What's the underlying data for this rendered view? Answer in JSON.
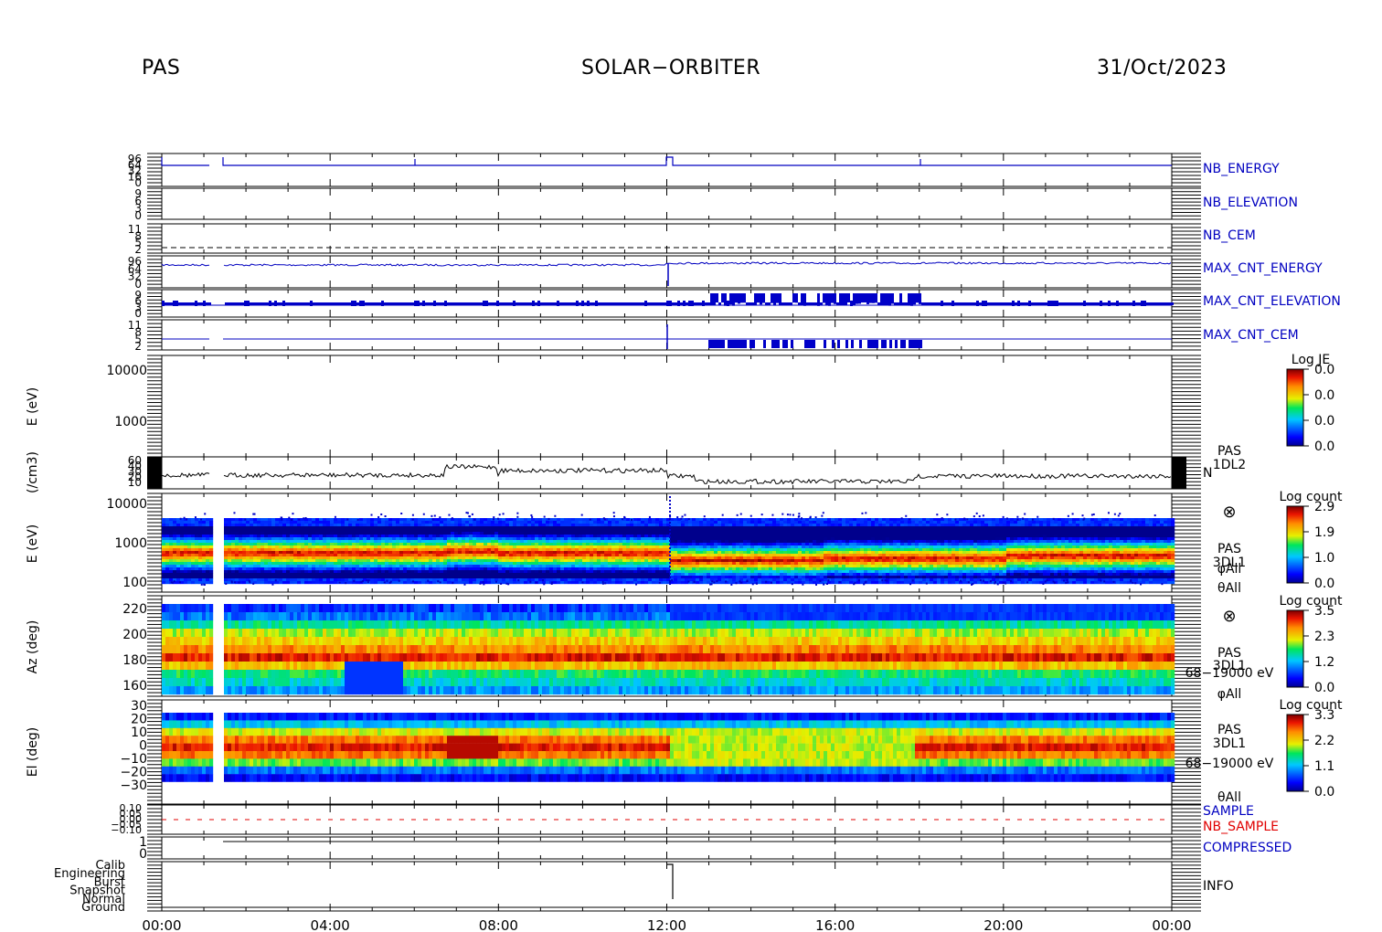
{
  "header": {
    "instrument": "PAS",
    "mission": "SOLAR−ORBITER",
    "date": "31/Oct/2023"
  },
  "chart_data": {
    "type": "heatmap",
    "x_tick_labels": [
      "00:00",
      "04:00",
      "08:00",
      "12:00",
      "16:00",
      "20:00",
      "00:00"
    ],
    "panels": [
      {
        "id": "nb_energy",
        "label": "NB_ENERGY",
        "label_color": "#0000c0",
        "ytick_labels": [
          "96",
          "64",
          "32",
          "16",
          "0"
        ],
        "trace": "step"
      },
      {
        "id": "nb_elevation",
        "label": "NB_ELEVATION",
        "label_color": "#0000c0",
        "ytick_labels": [
          "9",
          "6",
          "3",
          "0"
        ],
        "trace": "empty"
      },
      {
        "id": "nb_cem",
        "label": "NB_CEM",
        "label_color": "#0000c0",
        "ytick_labels": [
          "11",
          "8",
          "5",
          "2"
        ],
        "trace": "dashed"
      },
      {
        "id": "max_cnt_energy",
        "label": "MAX_CNT_ENERGY",
        "label_color": "#0000c0",
        "ytick_labels": [
          "96",
          "64",
          "32",
          "0"
        ],
        "trace": "noisy"
      },
      {
        "id": "max_cnt_elevation",
        "label": "MAX_CNT_ELEVATION",
        "label_color": "#0000c0",
        "ytick_labels": [
          "9",
          "6",
          "3",
          "0"
        ],
        "trace": "bursty"
      },
      {
        "id": "max_cnt_cem",
        "label": "MAX_CNT_CEM",
        "label_color": "#0000c0",
        "ytick_labels": [
          "11",
          "8",
          "5",
          "2"
        ],
        "trace": "bursty"
      },
      {
        "id": "e_1dl2",
        "ylabel": "E (eV)",
        "ytick_labels": [
          "10000",
          "1000"
        ],
        "colorbar": {
          "title": "Log JE",
          "ticks": [
            "0.0",
            "0.0",
            "0.0",
            "0.0"
          ]
        }
      },
      {
        "id": "density",
        "ylabel": "(/cm3)",
        "ytick_labels": [
          "60",
          "40",
          "30",
          "20",
          "10"
        ],
        "side_label": [
          "PAS",
          "1DL2"
        ],
        "trace_label": "N"
      },
      {
        "id": "e_3dl1",
        "ylabel": "E (eV)",
        "ytick_labels": [
          "10000",
          "1000",
          "100"
        ],
        "side_label": [
          "PAS",
          "3DL1",
          "φAll",
          "θAll"
        ],
        "colorbar": {
          "title": "Log count",
          "ticks": [
            "2.9",
            "1.9",
            "1.0",
            "0.0"
          ]
        }
      },
      {
        "id": "az",
        "ylabel": "Az (deg)",
        "ytick_labels": [
          "220",
          "200",
          "180",
          "160"
        ],
        "side_label": [
          "PAS",
          "3DL1",
          "68−19000 eV",
          "φAll"
        ],
        "colorbar": {
          "title": "Log count",
          "ticks": [
            "3.5",
            "2.3",
            "1.2",
            "0.0"
          ]
        }
      },
      {
        "id": "el",
        "ylabel": "El (deg)",
        "ytick_labels": [
          "30",
          "20",
          "10",
          "0",
          "−10",
          "−20",
          "−30"
        ],
        "side_label": [
          "PAS",
          "3DL1",
          "68−19000 eV",
          "θAll"
        ],
        "colorbar": {
          "title": "Log count",
          "ticks": [
            "3.3",
            "2.2",
            "1.1",
            "0.0"
          ]
        }
      },
      {
        "id": "sample",
        "labels": [
          {
            "text": "SAMPLE",
            "color": "#0000c0"
          },
          {
            "text": "NB_SAMPLE",
            "color": "#e00000"
          }
        ],
        "ytick_labels": [
          "0.10",
          "0.05",
          "0.00",
          "−0.05",
          "−0.10"
        ]
      },
      {
        "id": "compressed",
        "label": "COMPRESSED",
        "label_color": "#0000c0",
        "ytick_labels": [
          "1",
          "0"
        ]
      },
      {
        "id": "info",
        "label": "INFO",
        "label_color": "#000000",
        "ytick_labels": [
          "Calib",
          "Engineering",
          "Burst",
          "Snapshot",
          "Normal",
          "Ground"
        ]
      }
    ]
  }
}
